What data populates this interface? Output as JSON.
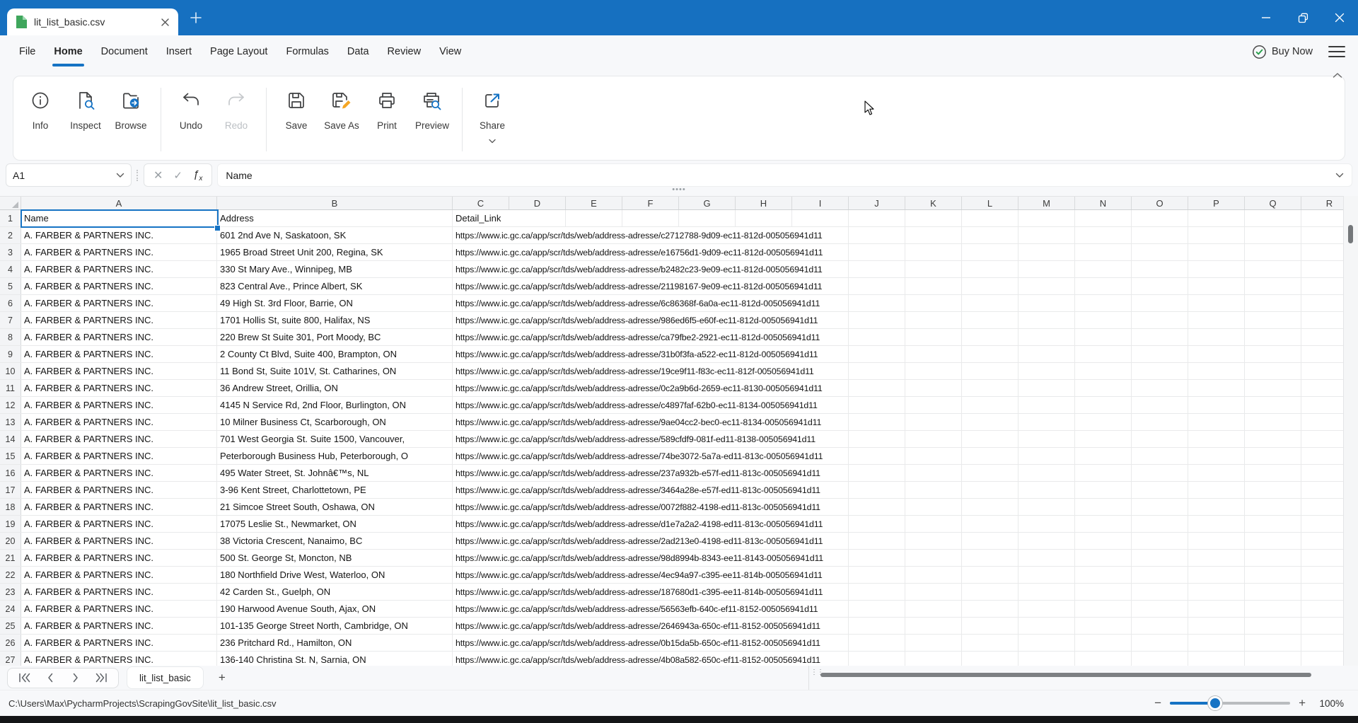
{
  "titlebar": {
    "tab_title": "lit_list_basic.csv",
    "new_tab_label": "+"
  },
  "menubar": {
    "items": [
      "File",
      "Home",
      "Document",
      "Insert",
      "Page Layout",
      "Formulas",
      "Data",
      "Review",
      "View"
    ],
    "active_index": 1,
    "buy_now_label": "Buy Now"
  },
  "toolbar": {
    "buttons": [
      {
        "label": "Info",
        "icon": "info-icon",
        "group": 0,
        "disabled": false,
        "has_dropdown": false
      },
      {
        "label": "Inspect",
        "icon": "inspect-icon",
        "group": 0,
        "disabled": false,
        "has_dropdown": false
      },
      {
        "label": "Browse",
        "icon": "browse-icon",
        "group": 0,
        "disabled": false,
        "has_dropdown": false
      },
      {
        "label": "Undo",
        "icon": "undo-icon",
        "group": 1,
        "disabled": false,
        "has_dropdown": false
      },
      {
        "label": "Redo",
        "icon": "redo-icon",
        "group": 1,
        "disabled": true,
        "has_dropdown": false
      },
      {
        "label": "Save",
        "icon": "save-icon",
        "group": 2,
        "disabled": false,
        "has_dropdown": false
      },
      {
        "label": "Save As",
        "icon": "save-as-icon",
        "group": 2,
        "disabled": false,
        "has_dropdown": false
      },
      {
        "label": "Print",
        "icon": "print-icon",
        "group": 2,
        "disabled": false,
        "has_dropdown": false
      },
      {
        "label": "Preview",
        "icon": "preview-icon",
        "group": 2,
        "disabled": false,
        "has_dropdown": false
      },
      {
        "label": "Share",
        "icon": "share-icon",
        "group": 3,
        "disabled": false,
        "has_dropdown": true
      }
    ]
  },
  "formula_bar": {
    "cell_ref": "A1",
    "content": "Name"
  },
  "grid": {
    "column_letters": [
      "A",
      "B",
      "C",
      "D",
      "E",
      "F",
      "G",
      "H",
      "I",
      "J",
      "K",
      "L",
      "M",
      "N",
      "O",
      "P",
      "Q",
      "R"
    ],
    "selected_cell": "A1",
    "header_row": [
      "Name",
      "Address",
      "Detail_Link"
    ],
    "rows": [
      {
        "name": "A. FARBER & PARTNERS INC.",
        "address": "601 2nd Ave N, Saskatoon, SK",
        "link": "https://www.ic.gc.ca/app/scr/tds/web/address-adresse/c2712788-9d09-ec11-812d-005056941d11"
      },
      {
        "name": "A. FARBER & PARTNERS INC.",
        "address": "1965 Broad Street Unit 200, Regina, SK",
        "link": "https://www.ic.gc.ca/app/scr/tds/web/address-adresse/e16756d1-9d09-ec11-812d-005056941d11"
      },
      {
        "name": "A. FARBER & PARTNERS INC.",
        "address": "330 St Mary Ave., Winnipeg, MB",
        "link": "https://www.ic.gc.ca/app/scr/tds/web/address-adresse/b2482c23-9e09-ec11-812d-005056941d11"
      },
      {
        "name": "A. FARBER & PARTNERS INC.",
        "address": "823 Central Ave., Prince Albert, SK",
        "link": "https://www.ic.gc.ca/app/scr/tds/web/address-adresse/21198167-9e09-ec11-812d-005056941d11"
      },
      {
        "name": "A. FARBER & PARTNERS INC.",
        "address": "49 High St. 3rd Floor, Barrie, ON",
        "link": "https://www.ic.gc.ca/app/scr/tds/web/address-adresse/6c86368f-6a0a-ec11-812d-005056941d11"
      },
      {
        "name": "A. FARBER & PARTNERS INC.",
        "address": "1701 Hollis St, suite 800, Halifax, NS",
        "link": "https://www.ic.gc.ca/app/scr/tds/web/address-adresse/986ed6f5-e60f-ec11-812d-005056941d11"
      },
      {
        "name": "A. FARBER & PARTNERS INC.",
        "address": "220 Brew St Suite 301, Port Moody, BC",
        "link": "https://www.ic.gc.ca/app/scr/tds/web/address-adresse/ca79fbe2-2921-ec11-812d-005056941d11"
      },
      {
        "name": "A. FARBER & PARTNERS INC.",
        "address": "2 County Ct Blvd, Suite 400, Brampton, ON",
        "link": "https://www.ic.gc.ca/app/scr/tds/web/address-adresse/31b0f3fa-a522-ec11-812d-005056941d11"
      },
      {
        "name": "A. FARBER & PARTNERS INC.",
        "address": "11 Bond St, Suite 101V, St. Catharines, ON",
        "link": "https://www.ic.gc.ca/app/scr/tds/web/address-adresse/19ce9f11-f83c-ec11-812f-005056941d11"
      },
      {
        "name": "A. FARBER & PARTNERS INC.",
        "address": "36 Andrew Street, Orillia, ON",
        "link": "https://www.ic.gc.ca/app/scr/tds/web/address-adresse/0c2a9b6d-2659-ec11-8130-005056941d11"
      },
      {
        "name": "A. FARBER & PARTNERS INC.",
        "address": "4145 N Service Rd, 2nd Floor, Burlington, ON",
        "link": "https://www.ic.gc.ca/app/scr/tds/web/address-adresse/c4897faf-62b0-ec11-8134-005056941d11"
      },
      {
        "name": "A. FARBER & PARTNERS INC.",
        "address": "10 Milner Business Ct, Scarborough, ON",
        "link": "https://www.ic.gc.ca/app/scr/tds/web/address-adresse/9ae04cc2-bec0-ec11-8134-005056941d11"
      },
      {
        "name": "A. FARBER & PARTNERS INC.",
        "address": "701 West Georgia St. Suite 1500, Vancouver,",
        "link": "https://www.ic.gc.ca/app/scr/tds/web/address-adresse/589cfdf9-081f-ed11-8138-005056941d11"
      },
      {
        "name": "A. FARBER & PARTNERS INC.",
        "address": "Peterborough Business Hub, Peterborough, O",
        "link": "https://www.ic.gc.ca/app/scr/tds/web/address-adresse/74be3072-5a7a-ed11-813c-005056941d11"
      },
      {
        "name": "A. FARBER & PARTNERS INC.",
        "address": "495 Water Street, St. Johnâ€™s, NL",
        "link": "https://www.ic.gc.ca/app/scr/tds/web/address-adresse/237a932b-e57f-ed11-813c-005056941d11"
      },
      {
        "name": "A. FARBER & PARTNERS INC.",
        "address": "3-96 Kent Street, Charlottetown, PE",
        "link": "https://www.ic.gc.ca/app/scr/tds/web/address-adresse/3464a28e-e57f-ed11-813c-005056941d11"
      },
      {
        "name": "A. FARBER & PARTNERS INC.",
        "address": "21 Simcoe Street South, Oshawa, ON",
        "link": "https://www.ic.gc.ca/app/scr/tds/web/address-adresse/0072f882-4198-ed11-813c-005056941d11"
      },
      {
        "name": "A. FARBER & PARTNERS INC.",
        "address": "17075 Leslie St., Newmarket, ON",
        "link": "https://www.ic.gc.ca/app/scr/tds/web/address-adresse/d1e7a2a2-4198-ed11-813c-005056941d11"
      },
      {
        "name": "A. FARBER & PARTNERS INC.",
        "address": "38 Victoria Crescent, Nanaimo, BC",
        "link": "https://www.ic.gc.ca/app/scr/tds/web/address-adresse/2ad213e0-4198-ed11-813c-005056941d11"
      },
      {
        "name": "A. FARBER & PARTNERS INC.",
        "address": "500 St. George St, Moncton, NB",
        "link": "https://www.ic.gc.ca/app/scr/tds/web/address-adresse/98d8994b-8343-ee11-8143-005056941d11"
      },
      {
        "name": "A. FARBER & PARTNERS INC.",
        "address": "180 Northfield Drive West, Waterloo, ON",
        "link": "https://www.ic.gc.ca/app/scr/tds/web/address-adresse/4ec94a97-c395-ee11-814b-005056941d11"
      },
      {
        "name": "A. FARBER & PARTNERS INC.",
        "address": "42 Carden St., Guelph, ON",
        "link": "https://www.ic.gc.ca/app/scr/tds/web/address-adresse/187680d1-c395-ee11-814b-005056941d11"
      },
      {
        "name": "A. FARBER & PARTNERS INC.",
        "address": "190 Harwood Avenue South, Ajax, ON",
        "link": "https://www.ic.gc.ca/app/scr/tds/web/address-adresse/56563efb-640c-ef11-8152-005056941d11"
      },
      {
        "name": "A. FARBER & PARTNERS INC.",
        "address": "101-135 George Street North, Cambridge, ON",
        "link": "https://www.ic.gc.ca/app/scr/tds/web/address-adresse/2646943a-650c-ef11-8152-005056941d11"
      },
      {
        "name": "A. FARBER & PARTNERS INC.",
        "address": "236 Pritchard Rd., Hamilton, ON",
        "link": "https://www.ic.gc.ca/app/scr/tds/web/address-adresse/0b15da5b-650c-ef11-8152-005056941d11"
      },
      {
        "name": "A. FARBER & PARTNERS INC.",
        "address": "136-140 Christina St. N, Sarnia, ON",
        "link": "https://www.ic.gc.ca/app/scr/tds/web/address-adresse/4b08a582-650c-ef11-8152-005056941d11"
      }
    ]
  },
  "sheet_bar": {
    "tab_label": "lit_list_basic",
    "add_label": "+"
  },
  "status_bar": {
    "file_path": "C:\\Users\\Max\\PycharmProjects\\ScrapingGovSite\\lit_list_basic.csv",
    "zoom_out": "−",
    "zoom_in": "+",
    "zoom_level": "100%"
  }
}
